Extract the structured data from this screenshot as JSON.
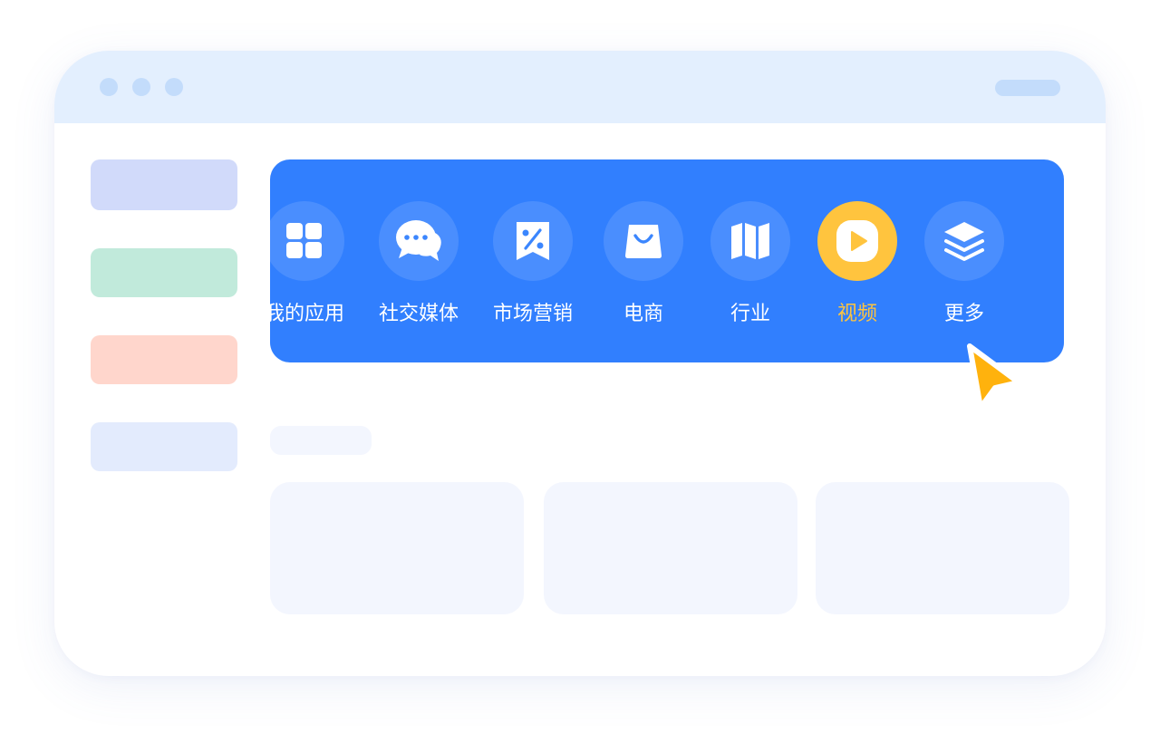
{
  "titlebar": {
    "controls": [
      "window-dot",
      "window-dot",
      "window-dot"
    ]
  },
  "sidebar": {
    "items": [
      {
        "color": "#d1dafa"
      },
      {
        "color": "#c1eadb"
      },
      {
        "color": "#ffd6cc"
      },
      {
        "color": "#e3ebfd"
      }
    ]
  },
  "nav": {
    "background": "#317ffe",
    "active_color": "#ffc43e",
    "items": [
      {
        "label": "我的应用",
        "icon": "grid-icon"
      },
      {
        "label": "社交媒体",
        "icon": "chat-bubbles-icon"
      },
      {
        "label": "市场营销",
        "icon": "discount-tag-icon"
      },
      {
        "label": "电商",
        "icon": "shopping-bag-icon"
      },
      {
        "label": "行业",
        "icon": "map-icon"
      },
      {
        "label": "视频",
        "icon": "play-icon",
        "active": true
      },
      {
        "label": "更多",
        "icon": "layers-icon"
      }
    ]
  },
  "content": {
    "section_title": "",
    "cards": [
      "",
      "",
      ""
    ]
  },
  "cursor": {
    "icon": "pointer-cursor-icon",
    "color": "#ffb20d"
  }
}
